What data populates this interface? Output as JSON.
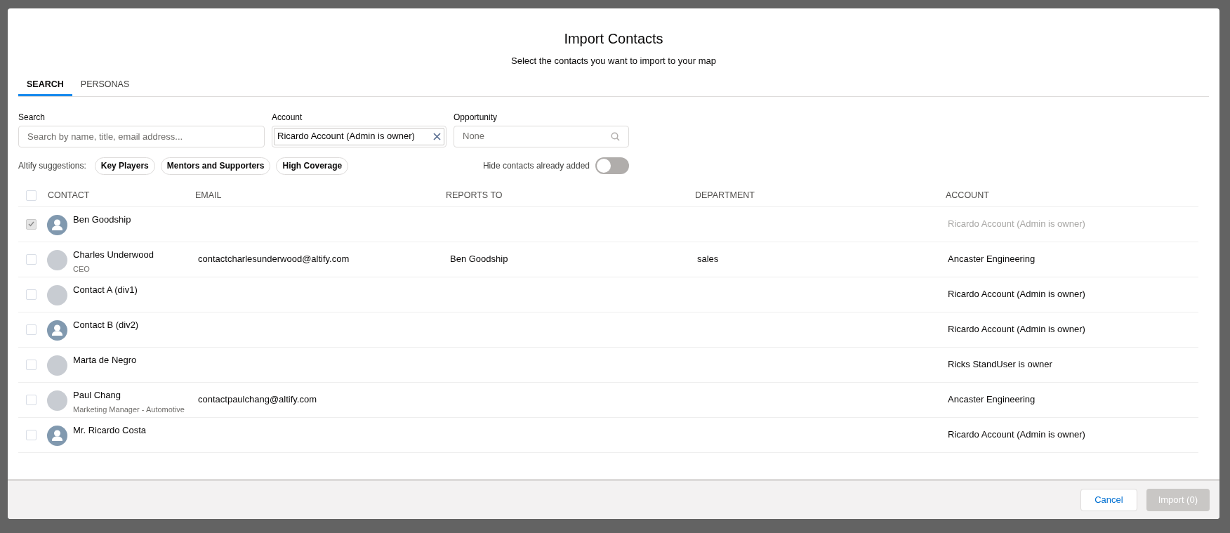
{
  "dialog": {
    "title": "Import Contacts",
    "subtitle": "Select the contacts you want to import to your map"
  },
  "tabs": [
    {
      "label": "SEARCH",
      "selected": true
    },
    {
      "label": "PERSONAS",
      "selected": false
    }
  ],
  "filters": {
    "search": {
      "label": "Search",
      "placeholder": "Search by name, title, email address..."
    },
    "account": {
      "label": "Account",
      "value": "Ricardo Account (Admin is owner)"
    },
    "opportunity": {
      "label": "Opportunity",
      "placeholder": "None"
    }
  },
  "suggestions": {
    "label": "Altify suggestions:",
    "chips": [
      "Key Players",
      "Mentors and Supporters",
      "High Coverage"
    ]
  },
  "hide_added": {
    "label": "Hide contacts already added",
    "on": false
  },
  "table": {
    "select_all": {
      "checked": false
    },
    "columns": [
      "CONTACT",
      "EMAIL",
      "REPORTS TO",
      "DEPARTMENT",
      "ACCOUNT"
    ],
    "rows": [
      {
        "checked": true,
        "disabled": true,
        "kind": "default",
        "name": "Ben Goodship",
        "account": "Ricardo Account (Admin is owner)"
      },
      {
        "checked": false,
        "disabled": false,
        "kind": "photo",
        "name": "Charles Underwood",
        "title": "CEO",
        "email": "contactcharlesunderwood@altify.com",
        "reports_to": "Ben Goodship",
        "department": "sales",
        "account": "Ancaster Engineering"
      },
      {
        "checked": false,
        "disabled": false,
        "kind": "photo",
        "name": "Contact A (div1)",
        "account": "Ricardo Account (Admin is owner)"
      },
      {
        "checked": false,
        "disabled": false,
        "kind": "default",
        "name": "Contact B (div2)",
        "account": "Ricardo Account (Admin is owner)"
      },
      {
        "checked": false,
        "disabled": false,
        "kind": "photo",
        "name": "Marta de Negro",
        "account": "Ricks StandUser is owner"
      },
      {
        "checked": false,
        "disabled": false,
        "kind": "photo",
        "name": "Paul Chang",
        "title": "Marketing Manager - Automotive",
        "email": "contactpaulchang@altify.com",
        "account": "Ancaster Engineering"
      },
      {
        "checked": false,
        "disabled": false,
        "kind": "default",
        "name": "Mr. Ricardo Costa",
        "account": "Ricardo Account (Admin is owner)"
      }
    ]
  },
  "footer": {
    "cancel": "Cancel",
    "import": {
      "label": "Import (0)",
      "disabled": true
    }
  }
}
